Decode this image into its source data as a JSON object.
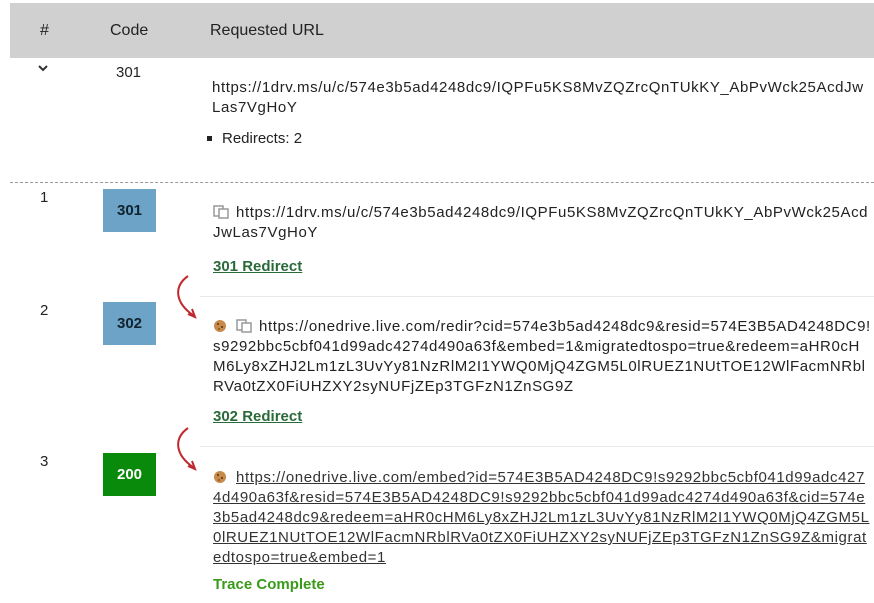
{
  "header": {
    "num_label": "#",
    "code_label": "Code",
    "url_label": "Requested URL"
  },
  "summary": {
    "code": "301",
    "url": "https://1drv.ms/u/c/574e3b5ad4248dc9/IQPFu5KS8MvZQZrcQnTUkKY_AbPvWck25AcdJwLas7VgHoY",
    "redirects": "Redirects: 2"
  },
  "rows": [
    {
      "num": "1",
      "code": "301",
      "code_color": "#6ca3c6",
      "url": "https://1drv.ms/u/c/574e3b5ad4248dc9/IQPFu5KS8MvZQZrcQnTUkKY_AbPvWck25AcdJwLas7VgHoY",
      "status": "301 Redirect"
    },
    {
      "num": "2",
      "code": "302",
      "code_color": "#6ca3c6",
      "url": "https://onedrive.live.com/redir?cid=574e3b5ad4248dc9&resid=574E3B5AD4248DC9!s9292bbc5cbf041d99adc4274d490a63f&embed=1&migratedtospo=true&redeem=aHR0cHM6Ly8xZHJ2Lm1zL3UvYy81NzRlM2I1YWQ0MjQ4ZGM5L0lRUEZ1NUtTOE12WlFacmNRblRVa0tZX0FiUHZXY2syNUFjZEp3TGFzN1ZnSG9Z",
      "status": "302 Redirect"
    },
    {
      "num": "3",
      "code": "200",
      "code_color": "#0a8a0a",
      "url": "https://onedrive.live.com/embed?id=574E3B5AD4248DC9!s9292bbc5cbf041d99adc4274d490a63f&resid=574E3B5AD4248DC9!s9292bbc5cbf041d99adc4274d490a63f&cid=574e3b5ad4248dc9&redeem=aHR0cHM6Ly8xZHJ2Lm1zL3UvYy81NzRlM2I1YWQ0MjQ4ZGM5L0lRUEZ1NUtTOE12WlFacmNRblRVa0tZX0FiUHZXY2syNUFjZEp3TGFzN1ZnSG9Z&migratedtospo=true&embed=1",
      "status": "Trace Complete"
    }
  ],
  "icons": {
    "toggle": "chevron-down-icon",
    "copy": "copy-icon",
    "cookie": "cookie-icon",
    "arrow": "curved-arrow-icon"
  }
}
